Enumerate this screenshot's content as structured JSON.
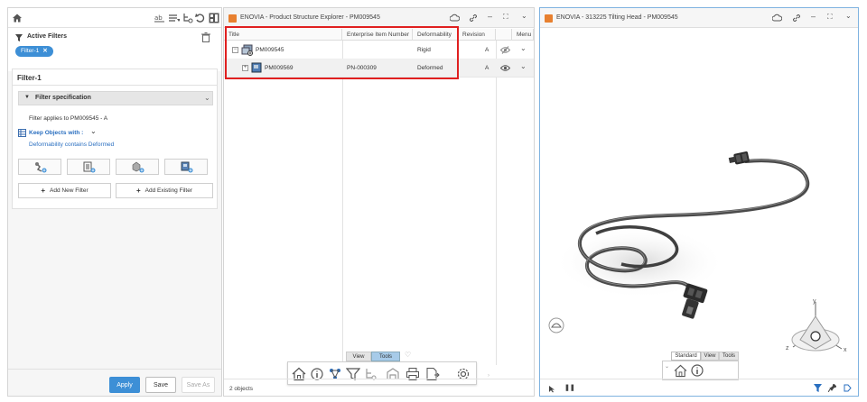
{
  "left_panel": {
    "toolbar": {
      "home_icon": "home-icon",
      "tools": [
        "filter-tree-icon",
        "filter-list-icon",
        "filter-hierarchy-icon",
        "undo-icon",
        "layout-icon"
      ]
    },
    "active_filters_label": "Active Filters",
    "filter_chip": "Filter-1",
    "filter_title": "Filter-1",
    "spec_header": "Filter specification",
    "applies_to": "Filter applies to PM009545 - A",
    "keep_objects": "Keep Objects with :",
    "condition": "Deformability contains Deformed",
    "add_new_filter": "Add New Filter",
    "add_existing_filter": "Add Existing Filter",
    "apply": "Apply",
    "save": "Save",
    "save_as": "Save As"
  },
  "explorer": {
    "title": "ENOVIA - Product Structure Explorer - PM009545",
    "columns": [
      "Title",
      "Enterprise Item Number",
      "Deformability",
      "Revision",
      "",
      "Menu"
    ],
    "rows": [
      {
        "title": "PM009545",
        "item_number": "",
        "deformability": "Rigid",
        "revision": "A"
      },
      {
        "title": "PM009569",
        "item_number": "PN-000309",
        "deformability": "Deformed",
        "revision": "A"
      }
    ],
    "tabs": [
      "View",
      "Tools"
    ],
    "status": "2 objects",
    "highlight_color": "#e02020"
  },
  "viewer": {
    "title": "ENOVIA - 313225 Tilting Head - PM009545",
    "tabs": [
      "Standard",
      "View",
      "Tools"
    ],
    "axes": {
      "x": "x",
      "y": "y",
      "z": "z"
    }
  },
  "colors": {
    "accent": "#3d8fd6",
    "enovia_orange": "#e8802f",
    "selection_border": "#7fb3e0"
  }
}
